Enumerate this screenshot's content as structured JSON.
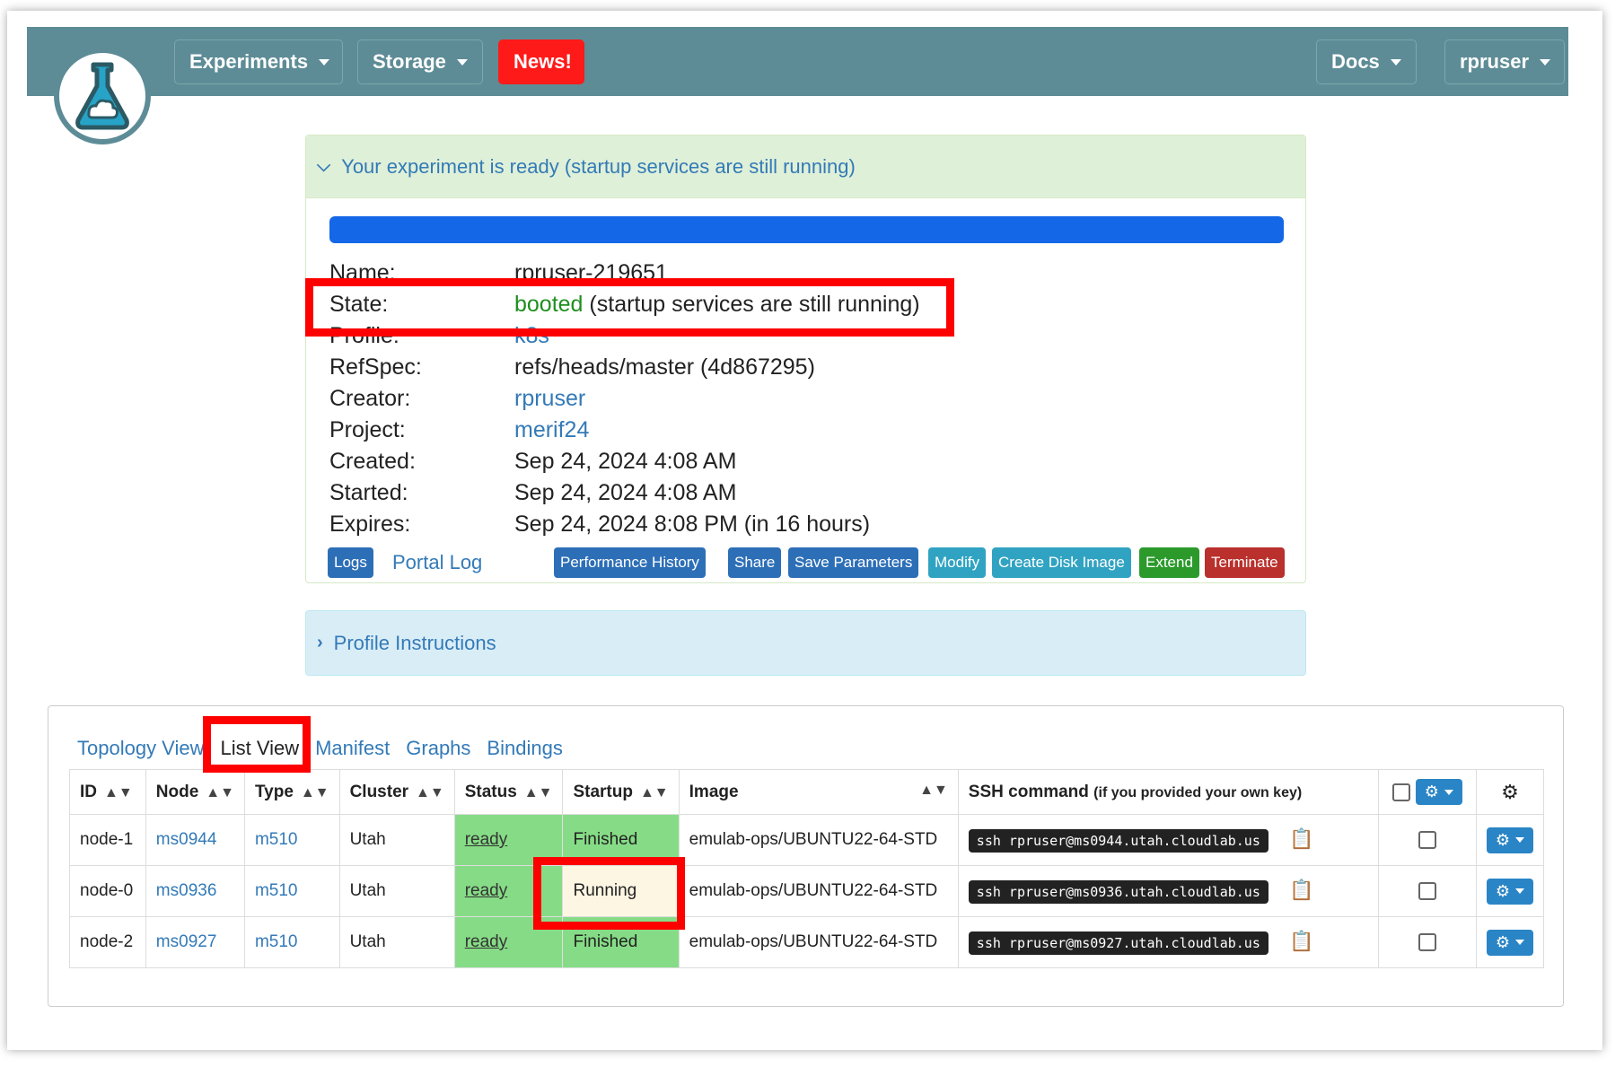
{
  "nav": {
    "experiments": "Experiments",
    "storage": "Storage",
    "news": "News!",
    "docs": "Docs",
    "user": "rpruser"
  },
  "alert": {
    "title": "Your experiment is ready (startup services are still running)",
    "progress_percent": 100
  },
  "info": {
    "name_label": "Name:",
    "name_value": "rpruser-219651",
    "state_label": "State:",
    "state_value": "booted",
    "state_note": "(startup services are still running)",
    "profile_label": "Profile:",
    "profile_value": "k8s",
    "refspec_label": "RefSpec:",
    "refspec_value": "refs/heads/master (4d867295)",
    "creator_label": "Creator:",
    "creator_value": "rpruser",
    "project_label": "Project:",
    "project_value": "merif24",
    "created_label": "Created:",
    "created_value": "Sep 24, 2024 4:08 AM",
    "started_label": "Started:",
    "started_value": "Sep 24, 2024 4:08 AM",
    "expires_label": "Expires:",
    "expires_value": "Sep 24, 2024 8:08 PM (in 16 hours)"
  },
  "actions": {
    "logs": "Logs",
    "portal_log": "Portal Log",
    "performance_history": "Performance History",
    "share": "Share",
    "save_parameters": "Save Parameters",
    "modify": "Modify",
    "create_disk_image": "Create Disk Image",
    "extend": "Extend",
    "terminate": "Terminate"
  },
  "profile_instructions": "Profile Instructions",
  "tabs": {
    "topology": "Topology View",
    "list": "List View",
    "manifest": "Manifest",
    "graphs": "Graphs",
    "bindings": "Bindings"
  },
  "table": {
    "headers": {
      "id": "ID",
      "node": "Node",
      "type": "Type",
      "cluster": "Cluster",
      "status": "Status",
      "startup": "Startup",
      "image": "Image",
      "ssh": "SSH command",
      "ssh_note": "(if you provided your own key)"
    },
    "rows": [
      {
        "id": "node-1",
        "node": "ms0944",
        "type": "m510",
        "cluster": "Utah",
        "status": "ready",
        "startup": "Finished",
        "image": "emulab-ops/UBUNTU22-64-STD",
        "ssh": "ssh rpruser@ms0944.utah.cloudlab.us"
      },
      {
        "id": "node-0",
        "node": "ms0936",
        "type": "m510",
        "cluster": "Utah",
        "status": "ready",
        "startup": "Running",
        "image": "emulab-ops/UBUNTU22-64-STD",
        "ssh": "ssh rpruser@ms0936.utah.cloudlab.us"
      },
      {
        "id": "node-2",
        "node": "ms0927",
        "type": "m510",
        "cluster": "Utah",
        "status": "ready",
        "startup": "Finished",
        "image": "emulab-ops/UBUNTU22-64-STD",
        "ssh": "ssh rpruser@ms0927.utah.cloudlab.us"
      }
    ]
  },
  "colors": {
    "navbar": "#5d8c96",
    "news": "#ff1a1a",
    "progress": "#1467e6",
    "highlight": "#ff0000",
    "ready_cell": "#86dc86"
  }
}
